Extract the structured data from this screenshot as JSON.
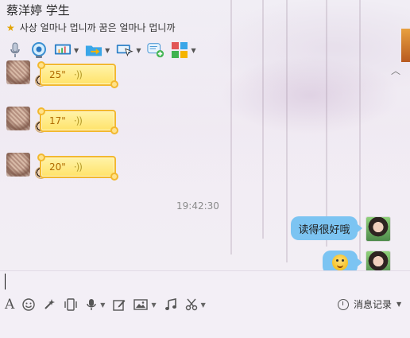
{
  "header": {
    "title": "蔡洋婷 学生",
    "status_text": "사상 얼마나 멉니까 꿈은 얼마나 멉니까"
  },
  "toolbar": {
    "items": [
      {
        "name": "microphone-icon",
        "has_caret": false
      },
      {
        "name": "webcam-icon",
        "has_caret": false
      },
      {
        "name": "screen-share-icon",
        "has_caret": true
      },
      {
        "name": "send-file-icon",
        "has_caret": true
      },
      {
        "name": "remote-assist-icon",
        "has_caret": true
      },
      {
        "name": "message-add-icon",
        "has_caret": false
      },
      {
        "name": "apps-icon",
        "has_caret": true
      }
    ]
  },
  "messages": [
    {
      "type": "voice",
      "duration": "25\""
    },
    {
      "type": "voice",
      "duration": "17\""
    },
    {
      "type": "voice",
      "duration": "20\""
    }
  ],
  "timestamp": "19:42:30",
  "outgoing": [
    {
      "type": "text",
      "text": "读得很好哦"
    },
    {
      "type": "emoji",
      "icon": "winking-face-icon"
    }
  ],
  "bottom_toolbar": {
    "history_label": "消息记录"
  },
  "colors": {
    "bubble": "#7cc4f2",
    "voice_bg": "#ffe36a",
    "voice_border": "#f2b82f"
  }
}
